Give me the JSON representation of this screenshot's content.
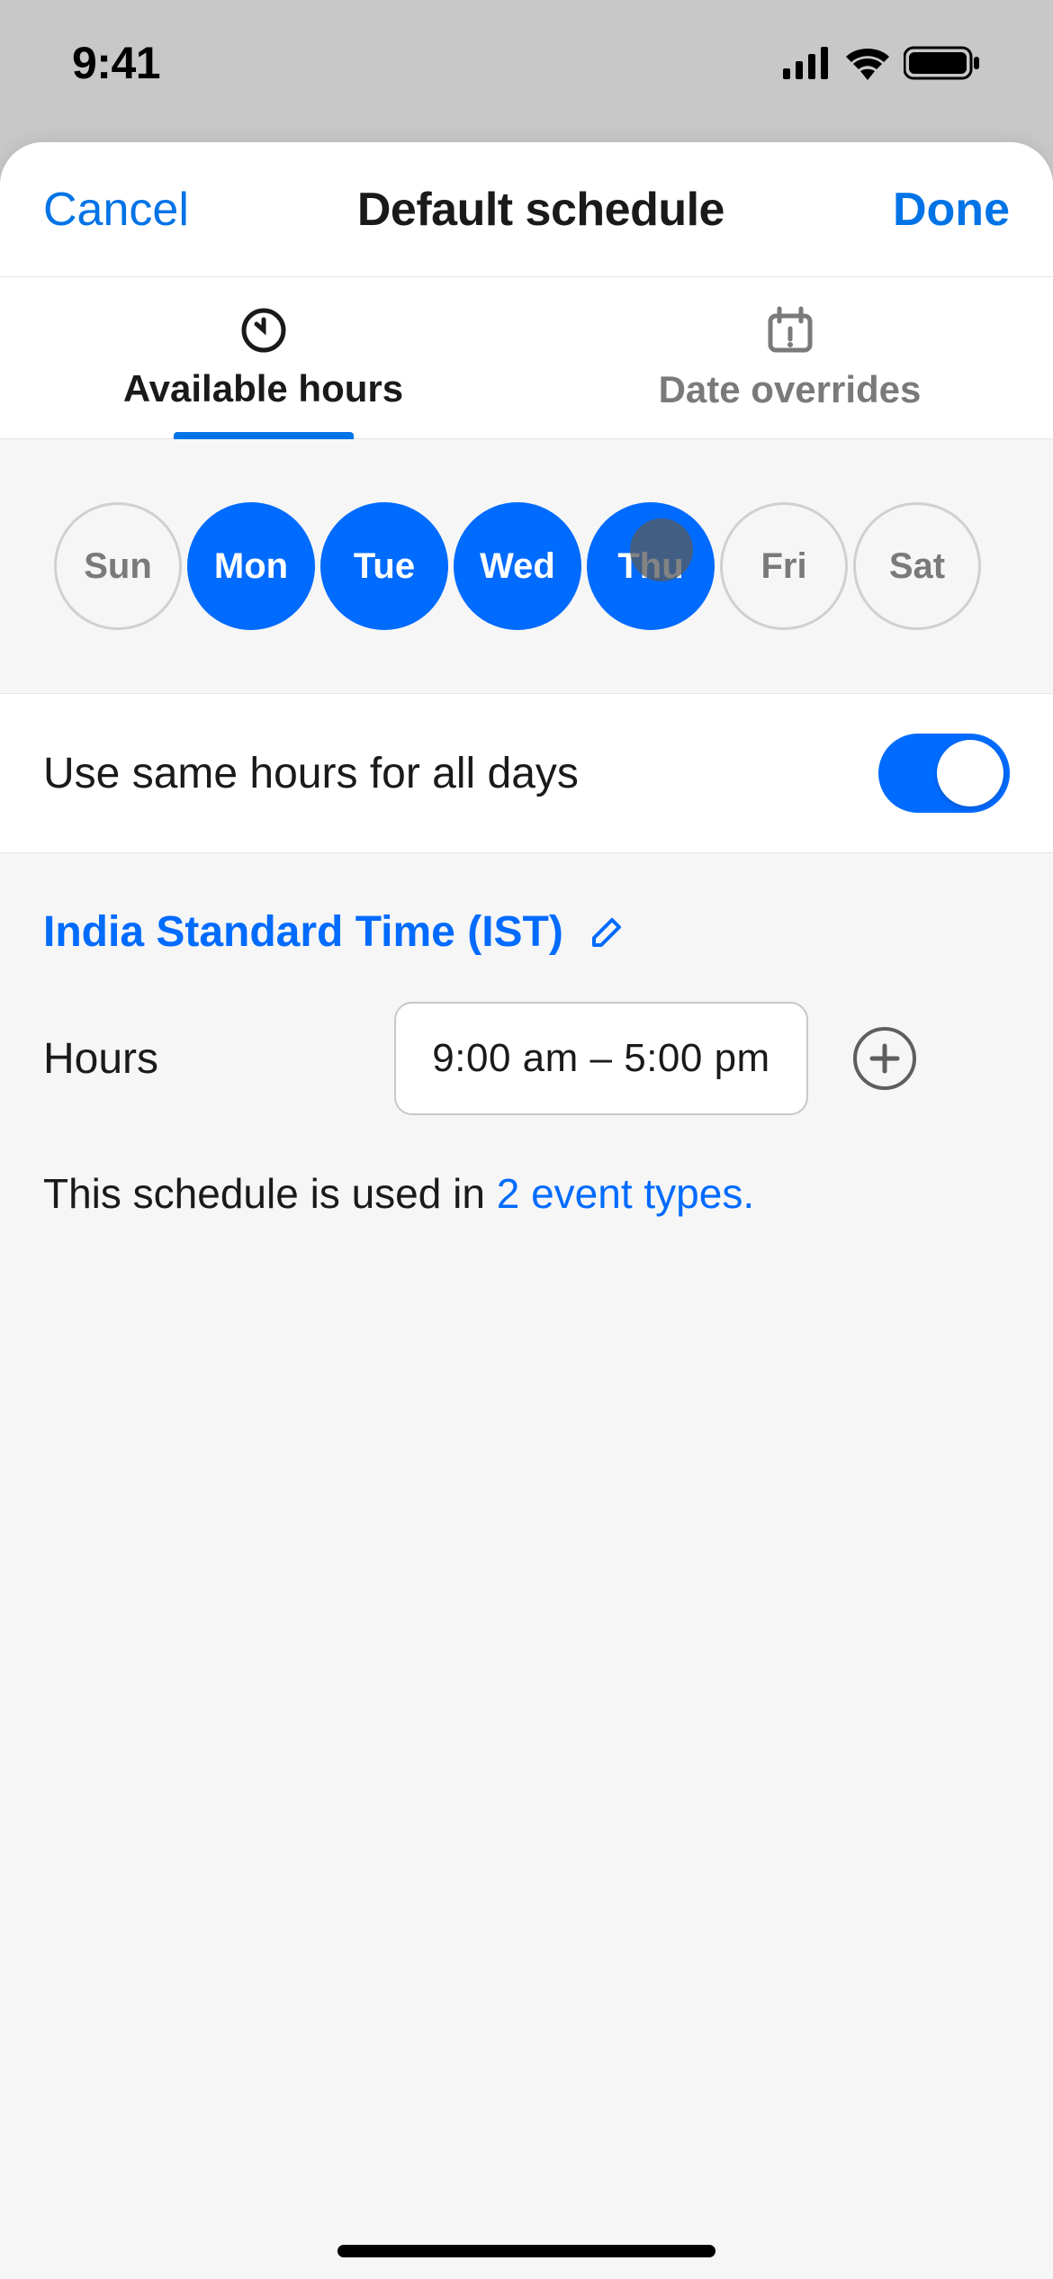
{
  "status": {
    "time": "9:41"
  },
  "header": {
    "cancel": "Cancel",
    "title": "Default schedule",
    "done": "Done"
  },
  "tabs": {
    "available": "Available hours",
    "overrides": "Date overrides"
  },
  "days": [
    {
      "label": "Sun",
      "selected": false
    },
    {
      "label": "Mon",
      "selected": true
    },
    {
      "label": "Tue",
      "selected": true
    },
    {
      "label": "Wed",
      "selected": true
    },
    {
      "label": "Thu",
      "selected": true
    },
    {
      "label": "Fri",
      "selected": false
    },
    {
      "label": "Sat",
      "selected": false
    }
  ],
  "same_hours": {
    "label": "Use same hours for all days",
    "on": true
  },
  "timezone": {
    "label": "India Standard Time (IST)"
  },
  "hours": {
    "label": "Hours",
    "start": "9:00 am",
    "sep": "–",
    "end": "5:00 pm"
  },
  "usage": {
    "prefix": "This schedule is used in ",
    "link": "2 event types."
  },
  "colors": {
    "accent": "#006bff",
    "link": "#0073e6"
  }
}
